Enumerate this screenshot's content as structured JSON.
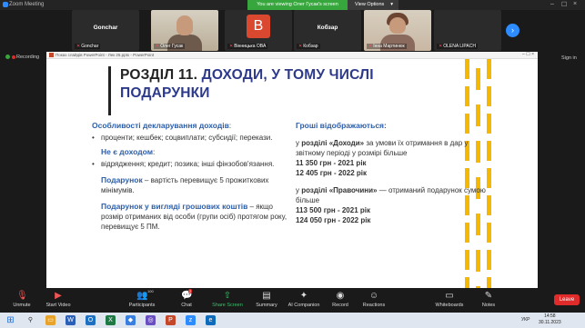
{
  "window": {
    "app_name": "Zoom Meeting"
  },
  "banner": {
    "viewing": "You are viewing Олег Гусак's screen",
    "view_options": "View Options"
  },
  "participants": [
    {
      "name_big": "Gonchar",
      "label": "Gonchar",
      "type": "name"
    },
    {
      "name_big": "",
      "label": "Олег Гусак",
      "type": "video"
    },
    {
      "name_big": "",
      "label": "Вінницька ОВА",
      "type": "avatar",
      "avatar_letter": "B"
    },
    {
      "name_big": "Кобзар",
      "label": "Кобзар",
      "type": "name"
    },
    {
      "name_big": "",
      "label": "Інна Мартинюк",
      "type": "video"
    },
    {
      "name_big": "",
      "label": "OLENA LIPACH",
      "type": "blank"
    }
  ],
  "share_bar": {
    "recording": "Recording",
    "sign_in": "Sign in"
  },
  "ppt": {
    "title": "Показ слайдів PowerPoint - Лек 25.pptx - PowerPoint"
  },
  "slide": {
    "title_part1": "РОЗДІЛ 11.",
    "title_part2": "ДОХОДИ, У ТОМУ ЧИСЛІ",
    "title_part3": "ПОДАРУНКИ",
    "left": {
      "h1": "Особливості декларування доходів",
      "h1_colon": ":",
      "b1": "проценти; кешбек; соцвиплати; субсидії; перекази.",
      "h2": "Не є доходом",
      "h2_colon": ":",
      "b2": "відрядження; кредит; позика; інші фінзобов'язання.",
      "gift_label": "Подарунок",
      "gift_text": " – вартість перевищує 5 прожиткових мінімумів.",
      "cash_label": "Подарунок у вигляді грошових коштів",
      "cash_text": " – якщо розмір отриманих від особи (групи осіб) протягом року, перевищує 5 ПМ."
    },
    "right": {
      "h": "Гроші відображаються:",
      "p1_pre": "у ",
      "p1_bold": "розділі «Доходи»",
      "p1_post": " за умови їх отримання в дар у звітному періоді у розмірі більше",
      "v1": "11 350 грн - 2021 рік",
      "v2": "12 405 грн - 2022 рік",
      "p2_pre": "у ",
      "p2_bold": "розділі «Правочини»",
      "p2_post": " — отриманий подарунок сумою більше",
      "v3": "113 500 грн - 2021 рік",
      "v4": "124 050 грн - 2022 рік"
    }
  },
  "toolbar": {
    "unmute": "Unmute",
    "start_video": "Start Video",
    "participants": "Participants",
    "participants_count": "100",
    "chat": "Chat",
    "chat_badge": "2",
    "share_screen": "Share Screen",
    "summary": "Summary",
    "ai": "AI Companion",
    "record": "Record",
    "reactions": "Reactions",
    "whiteboards": "Whiteboards",
    "notes": "Notes",
    "leave": "Leave"
  },
  "taskbar": {
    "lang": "УКР",
    "time": "14:58",
    "date": "30.11.2023"
  }
}
